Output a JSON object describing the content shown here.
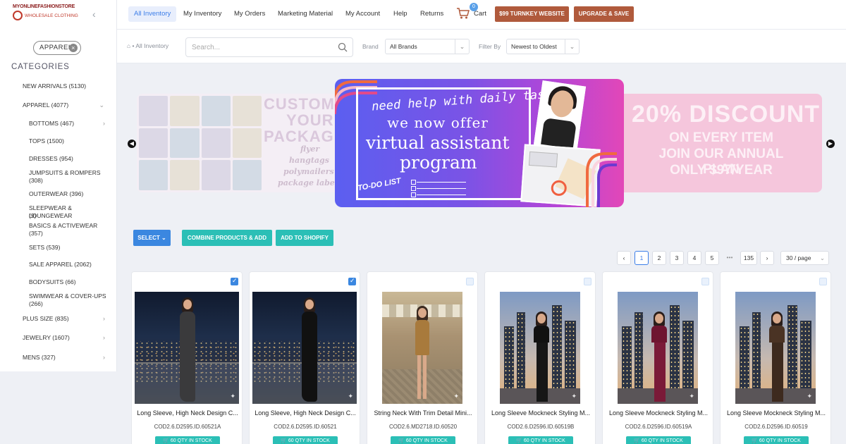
{
  "brand": {
    "line1": "MYONLINEFASHIONSTORE",
    "line2": "WHOLESALE CLOTHING"
  },
  "sidebar": {
    "filter_chip": "APPAREL",
    "categories_title": "CATEGORIES",
    "items": [
      {
        "label": "NEW ARRIVALS (5130)"
      },
      {
        "label": "APPAREL (4077)"
      },
      {
        "label": "BOTTOMS (467)"
      },
      {
        "label": "TOPS (1500)"
      },
      {
        "label": "DRESSES (954)"
      },
      {
        "label": "JUMPSUITS & ROMPERS"
      },
      {
        "label": "(308)"
      },
      {
        "label": "OUTERWEAR (396)"
      },
      {
        "label": "SLEEPWEAR & LOUNGEWEAR"
      },
      {
        "label": "(9)"
      },
      {
        "label": "BASICS & ACTIVEWEAR"
      },
      {
        "label": "(357)"
      },
      {
        "label": "SETS (539)"
      },
      {
        "label": "SALE APPAREL (2062)"
      },
      {
        "label": "BODYSUITS (66)"
      },
      {
        "label": "SWIMWEAR & COVER-UPS"
      },
      {
        "label": "(266)"
      },
      {
        "label": "PLUS SIZE (835)"
      },
      {
        "label": "JEWELRY (1607)"
      },
      {
        "label": "MENS (327)"
      }
    ]
  },
  "topnav": {
    "items": [
      "All Inventory",
      "My Inventory",
      "My Orders",
      "Marketing Material",
      "My Account",
      "Help",
      "Returns"
    ],
    "cart_label": "Cart",
    "cart_count": "0",
    "turnkey_button": "$99 TURNKEY WEBSITE",
    "upgrade_button": "UPGRADE & SAVE"
  },
  "filters": {
    "breadcrumb": "All Inventory",
    "search_placeholder": "Search...",
    "brand_label": "Brand",
    "brand_value": "All Brands",
    "filter_label": "Filter By",
    "filter_value": "Newest to Oldest"
  },
  "banner": {
    "left_big": [
      "CUSTOMI",
      "YOUR",
      "PACKAGI"
    ],
    "left_small": [
      "flyer",
      "hangtags",
      "polymailers",
      "package label"
    ],
    "main_line1": "need help with daily tasks?",
    "main_line2": "we now offer",
    "main_line3": "virtual assistant",
    "main_line4": "program",
    "main_todo": "TO-DO LIST",
    "right_line1": "20% DISCOUNT",
    "right_line2": "ON EVERY ITEM",
    "right_line3": "JOIN OUR ANNUAL PLAN",
    "right_line4": "ONLY $97/YEAR"
  },
  "actions": {
    "select": "SELECT",
    "combine": "COMBINE PRODUCTS & ADD",
    "shopify": "ADD TO SHOPIFY"
  },
  "pagination": {
    "pages": [
      "1",
      "2",
      "3",
      "4",
      "5"
    ],
    "ellipsis": "•••",
    "last": "135",
    "per_page": "30 / page"
  },
  "products": [
    {
      "name": "Long Sleeve, High Neck Design C...",
      "sku": "COD2.6.D2595.ID.60521A",
      "stock": "60 QTY IN STOCK",
      "checked": true
    },
    {
      "name": "Long Sleeve, High Neck Design C...",
      "sku": "COD2.6.D2595.ID.60521",
      "stock": "60 QTY IN STOCK",
      "checked": true
    },
    {
      "name": "String Neck With Trim Detail Mini...",
      "sku": "COD2.6.MD2718.ID.60520",
      "stock": "60 QTY IN STOCK",
      "checked": false
    },
    {
      "name": "Long Sleeve Mockneck Styling M...",
      "sku": "COD2.6.D2596.ID.60519B",
      "stock": "60 QTY IN STOCK",
      "checked": false
    },
    {
      "name": "Long Sleeve Mockneck Styling M...",
      "sku": "COD2.6.D2596.ID.60519A",
      "stock": "60 QTY IN STOCK",
      "checked": false
    },
    {
      "name": "Long Sleeve Mockneck Styling M...",
      "sku": "COD2.6.D2596.ID.60519",
      "stock": "60 QTY IN STOCK",
      "checked": false
    }
  ],
  "colors": {
    "accent": "#3b7de8",
    "teal": "#2bbfb6",
    "brown": "#b05a3c",
    "select_blue": "#3b87e0"
  }
}
